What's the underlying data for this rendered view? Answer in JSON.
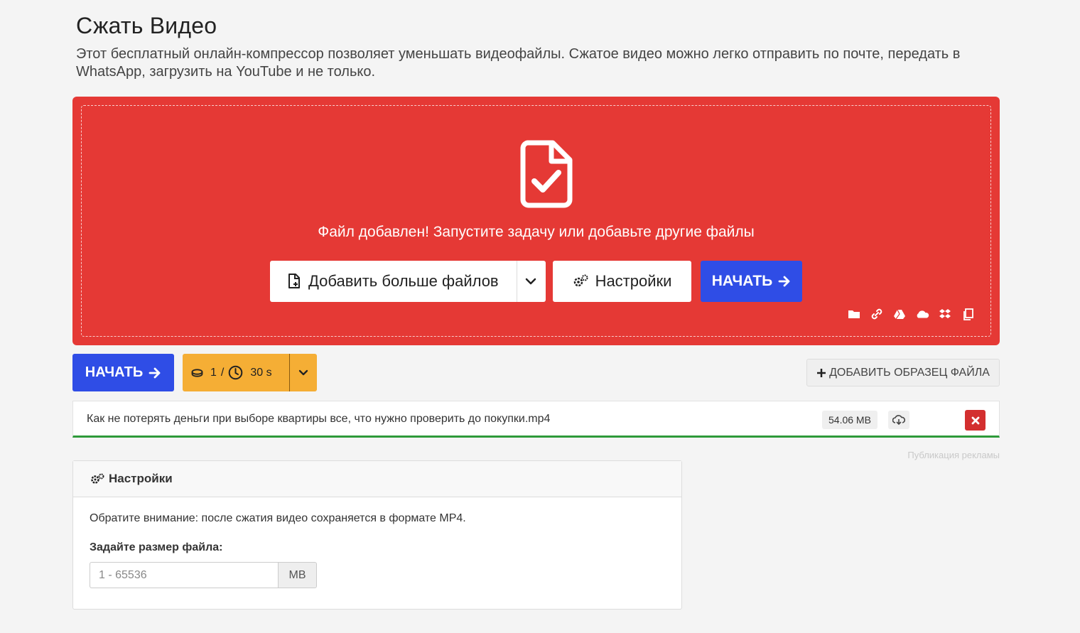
{
  "header": {
    "title": "Сжать Видео",
    "description": "Этот бесплатный онлайн-компрессор позволяет уменьшать видеофайлы. Сжатое видео можно легко отправить по почте, передать в WhatsApp, загрузить на YouTube и не только."
  },
  "dropzone": {
    "message": "Файл добавлен! Запустите задачу или добавьте другие файлы",
    "add_more_label": "Добавить больше файлов",
    "settings_label": "Настройки",
    "start_label": "НАЧАТЬ",
    "source_icons": [
      "folder-icon",
      "link-icon",
      "google-drive-icon",
      "onedrive-icon",
      "dropbox-icon",
      "clipboard-icon"
    ],
    "color": "#e53935"
  },
  "toolbar": {
    "start_label": "НАЧАТЬ",
    "credits_value": "1",
    "credits_sep": "/",
    "time_value": "30 s",
    "add_sample_label": "ДОБАВИТЬ ОБРАЗЕЦ ФАЙЛА"
  },
  "file": {
    "name": "Как не потерять деньги при выборе квартиры все, что нужно проверить до покупки.mp4",
    "size": "54.06 MB",
    "progress": 1.0
  },
  "ad_label": "Публикация рекламы",
  "settings": {
    "title": "Настройки",
    "note": "Обратите внимание: после сжатия видео сохраняется в формате MP4.",
    "size_label": "Задайте размер файла:",
    "size_placeholder": "1 - 65536",
    "size_value": "",
    "size_unit": "MB"
  },
  "colors": {
    "primary_blue": "#2f4de6",
    "credits_orange": "#f5ae35",
    "progress_green": "#2e9a3a",
    "delete_red": "#d32f2f"
  }
}
